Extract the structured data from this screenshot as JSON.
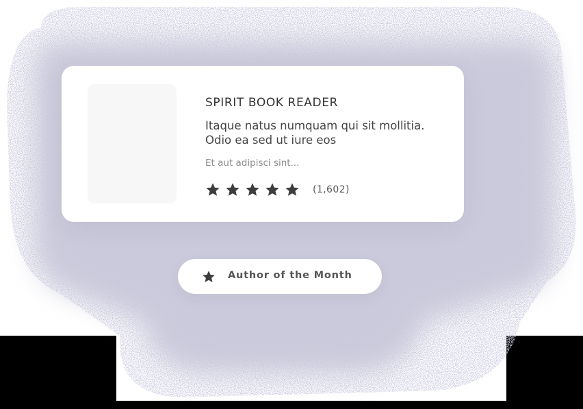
{
  "book_card": {
    "title": "SPIRIT BOOK READER",
    "description": "Itaque natus numquam qui sit mollitia. Odio ea sed ut iure eos",
    "excerpt": "Et aut adipisci sint...",
    "rating_stars": 5,
    "rating_max": 5,
    "review_count": "(1,602)",
    "star_icon": "star-icon",
    "star_color": "#3d3d3d"
  },
  "badge": {
    "label": "Author of the Month",
    "icon": "star-icon"
  },
  "colors": {
    "glow": "#cdcde0",
    "card_background": "#ffffff",
    "cover_placeholder": "#f7f7f7",
    "page_background": "#000000"
  }
}
